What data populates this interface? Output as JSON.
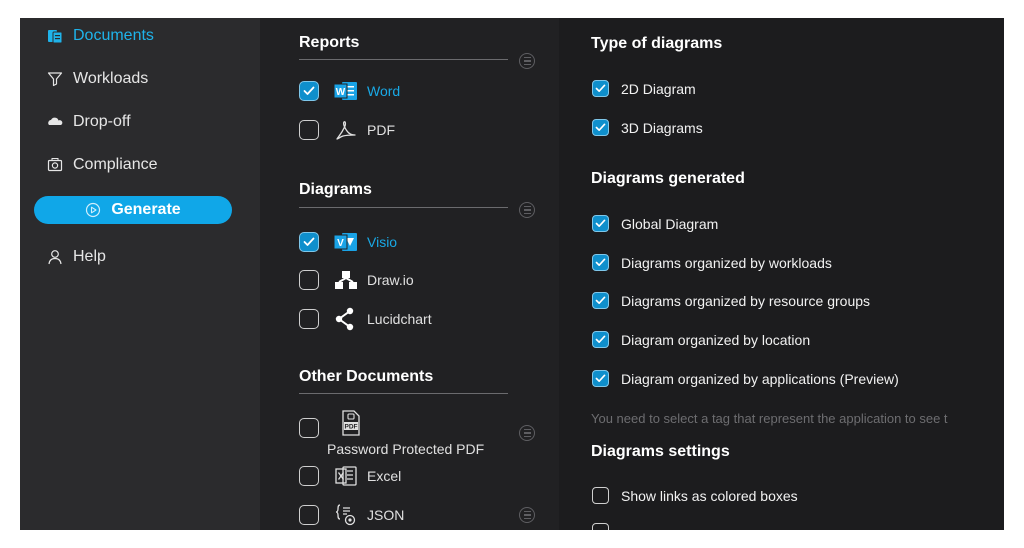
{
  "sidebar": {
    "items": [
      {
        "label": "Documents",
        "icon": "documents-icon",
        "active": true
      },
      {
        "label": "Workloads",
        "icon": "funnel-icon",
        "active": false
      },
      {
        "label": "Drop-off",
        "icon": "cloud-icon",
        "active": false
      },
      {
        "label": "Compliance",
        "icon": "camera-icon",
        "active": false
      }
    ],
    "generate_label": "Generate",
    "help_label": "Help"
  },
  "reports": {
    "title": "Reports",
    "items": [
      {
        "label": "Word",
        "checked": true,
        "icon": "word-icon"
      },
      {
        "label": "PDF",
        "checked": false,
        "icon": "pdf-icon"
      }
    ]
  },
  "diagrams": {
    "title": "Diagrams",
    "items": [
      {
        "label": "Visio",
        "checked": true,
        "icon": "visio-icon"
      },
      {
        "label": "Draw.io",
        "checked": false,
        "icon": "drawio-icon"
      },
      {
        "label": "Lucidchart",
        "checked": false,
        "icon": "lucidchart-icon"
      }
    ]
  },
  "other_documents": {
    "title": "Other Documents",
    "items": [
      {
        "label": "Password Protected PDF",
        "checked": false,
        "icon": "protected-pdf-icon"
      },
      {
        "label": "Excel",
        "checked": false,
        "icon": "excel-icon"
      },
      {
        "label": "JSON",
        "checked": false,
        "icon": "json-icon"
      }
    ]
  },
  "type_of_diagrams": {
    "title": "Type of diagrams",
    "items": [
      {
        "label": "2D Diagram",
        "checked": true
      },
      {
        "label": "3D Diagrams",
        "checked": true
      }
    ]
  },
  "diagrams_generated": {
    "title": "Diagrams generated",
    "items": [
      {
        "label": "Global Diagram",
        "checked": true
      },
      {
        "label": "Diagrams organized by workloads",
        "checked": true
      },
      {
        "label": "Diagrams organized by resource groups",
        "checked": true
      },
      {
        "label": "Diagram organized by location",
        "checked": true
      },
      {
        "label": "Diagram organized by applications (Preview)",
        "checked": true
      }
    ],
    "hint": "You need to select a tag that represent the application to see t"
  },
  "diagrams_settings": {
    "title": "Diagrams settings",
    "items": [
      {
        "label": "Show links as colored boxes",
        "checked": false
      }
    ]
  },
  "colors": {
    "accent": "#10a7e8",
    "active_text": "#1fb3ea",
    "checkbox_on": "#0f8fcc"
  }
}
